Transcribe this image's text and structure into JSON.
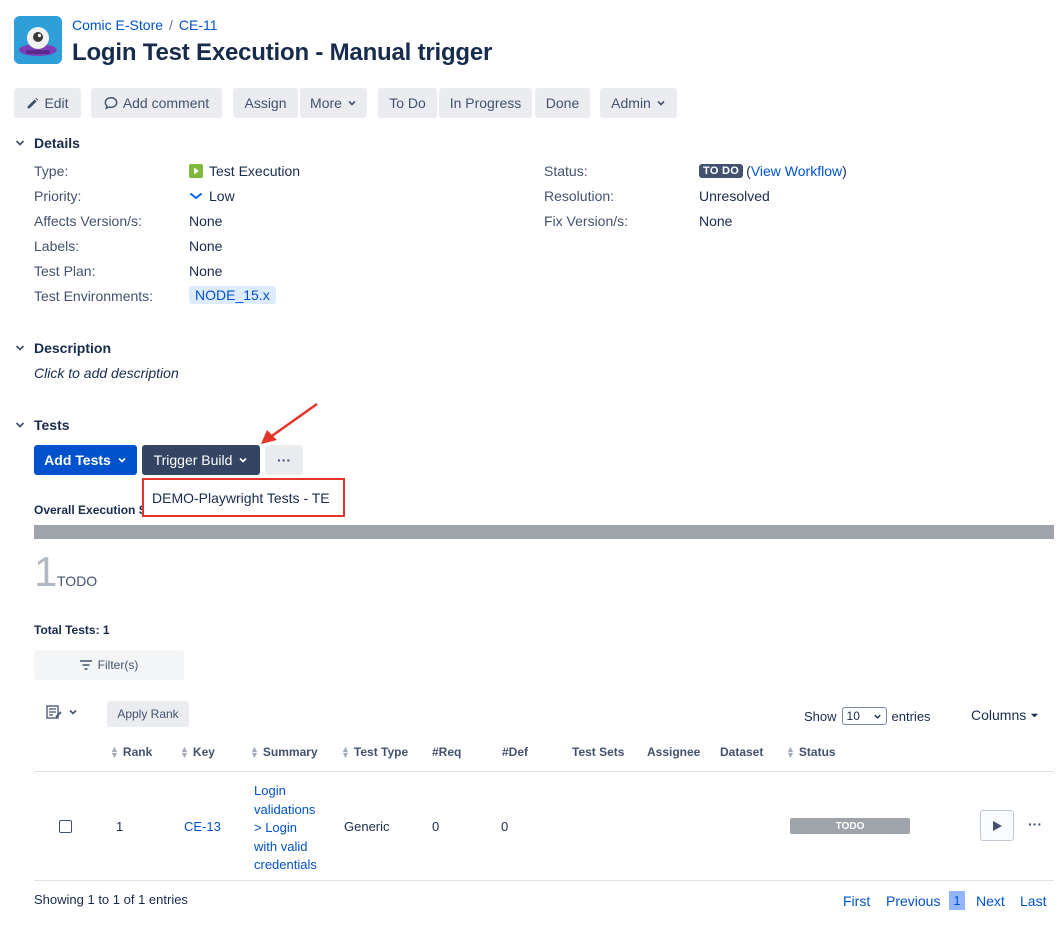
{
  "breadcrumb": {
    "project": "Comic E-Store",
    "sep": "/",
    "issue_key": "CE-11"
  },
  "title": "Login Test Execution - Manual trigger",
  "toolbar": {
    "edit": "Edit",
    "add_comment": "Add comment",
    "assign": "Assign",
    "more": "More",
    "todo": "To Do",
    "in_progress": "In Progress",
    "done": "Done",
    "admin": "Admin"
  },
  "details": {
    "header": "Details",
    "type_label": "Type:",
    "type_value": "Test Execution",
    "priority_label": "Priority:",
    "priority_value": "Low",
    "affects_label": "Affects Version/s:",
    "affects_value": "None",
    "labels_label": "Labels:",
    "labels_value": "None",
    "testplan_label": "Test Plan:",
    "testplan_value": "None",
    "env_label": "Test Environments:",
    "env_value": "NODE_15.x",
    "status_label": "Status:",
    "status_value": "TO DO",
    "status_open": "(",
    "workflow_link": "View Workflow",
    "status_close": ")",
    "resolution_label": "Resolution:",
    "resolution_value": "Unresolved",
    "fix_label": "Fix Version/s:",
    "fix_value": "None"
  },
  "description": {
    "header": "Description",
    "placeholder": "Click to add description"
  },
  "tests": {
    "header": "Tests",
    "add_tests": "Add Tests",
    "trigger_build": "Trigger Build",
    "more": "···",
    "dropdown_item": "DEMO-Playwright Tests - TE",
    "overall_label": "Overall Execution S",
    "count": "1",
    "count_status": "TODO",
    "total": "Total Tests: 1",
    "filter": "Filter(s)",
    "apply_rank": "Apply Rank",
    "show": "Show",
    "entries_value": "10",
    "entries": "entries",
    "columns": "Columns",
    "headers": [
      "Rank",
      "Key",
      "Summary",
      "Test Type",
      "#Req",
      "#Def",
      "Test Sets",
      "Assignee",
      "Dataset",
      "Status"
    ],
    "row": {
      "rank": "1",
      "key": "CE-13",
      "summary_lines": [
        "Login",
        "validations",
        "> Login",
        "with valid",
        "credentials"
      ],
      "test_type": "Generic",
      "req": "0",
      "def": "0",
      "status": "TODO"
    },
    "showing": "Showing 1 to 1 of 1 entries",
    "pager": {
      "first": "First",
      "previous": "Previous",
      "page": "1",
      "next": "Next",
      "last": "Last"
    }
  },
  "colors": {
    "primary": "#0052cc",
    "dark": "#344563",
    "annotation": "#e5352b",
    "todo_bar": "#9fa4ab"
  }
}
